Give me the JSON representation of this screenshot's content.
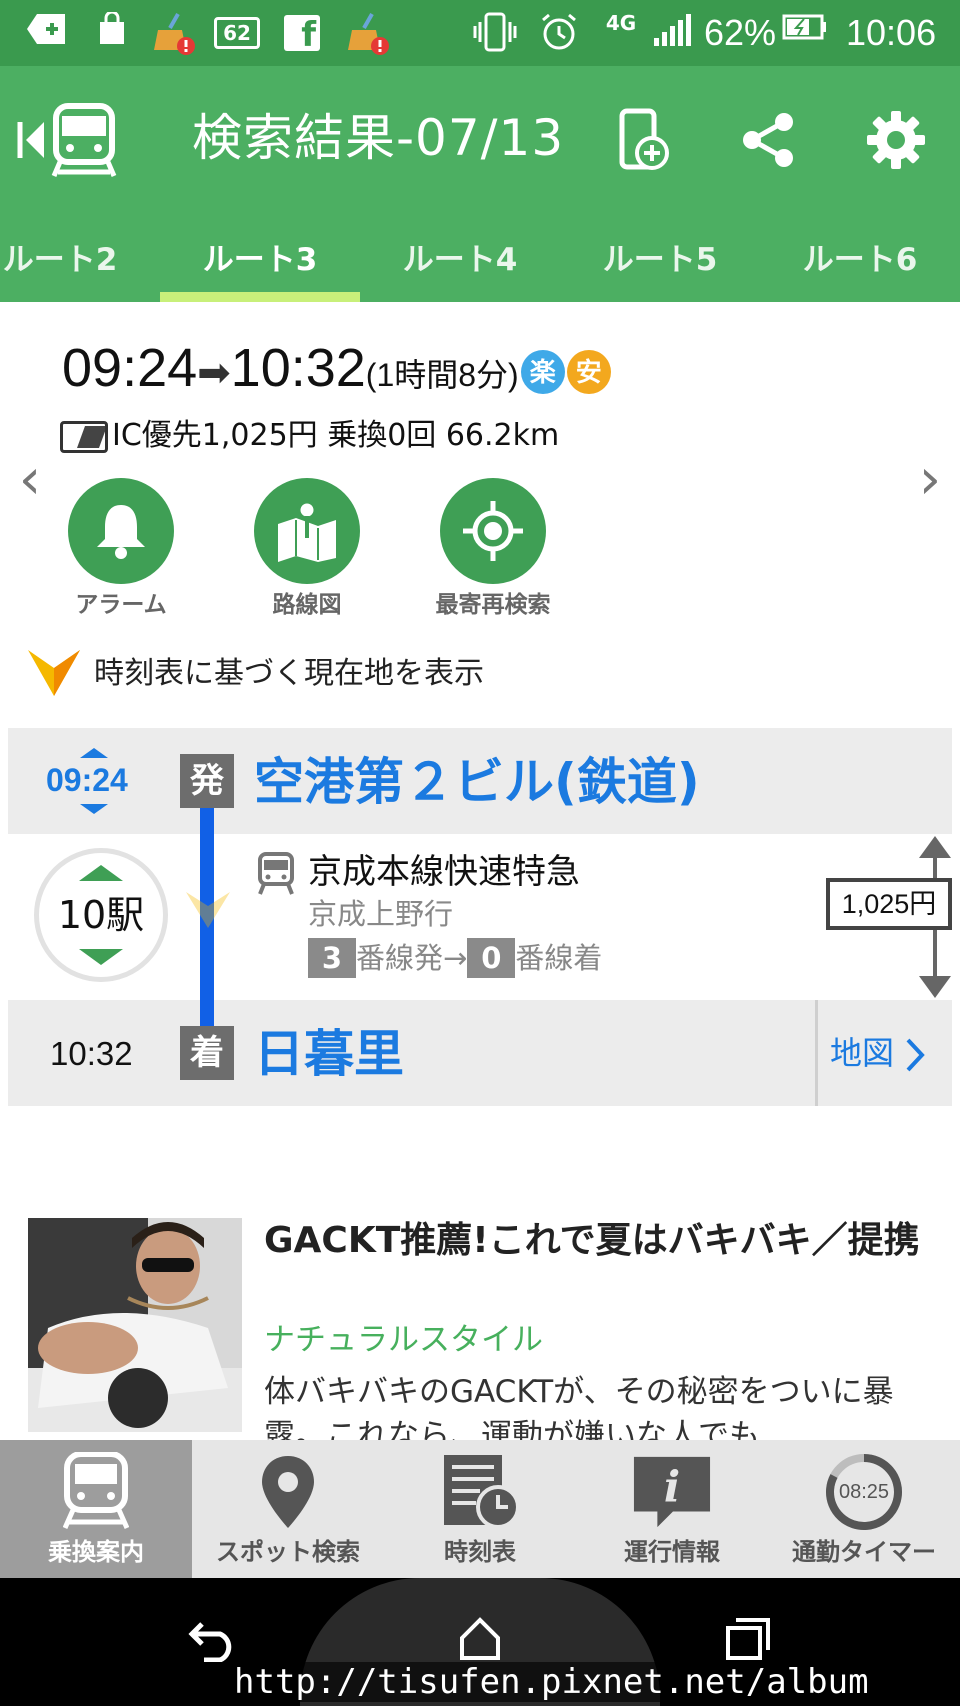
{
  "status_bar": {
    "battery_percent": "62%",
    "time": "10:06",
    "network": "4G",
    "notif_badge": "62",
    "facebook_glyph": "f",
    "icons": [
      "usb-plus-icon",
      "shopping-bag-icon",
      "broom-alert-icon",
      "badge-62-icon",
      "facebook-icon",
      "broom-alert-icon",
      "vibrate-icon",
      "alarm-icon",
      "4g-icon",
      "signal-icon",
      "battery-charging-icon"
    ]
  },
  "header": {
    "title": "検索結果-07/13",
    "icons": [
      "back-train-icon",
      "phone-add-icon",
      "share-icon",
      "settings-gear-icon"
    ]
  },
  "tabs": [
    {
      "label": "ルート2"
    },
    {
      "label": "ルート3"
    },
    {
      "label": "ルート4"
    },
    {
      "label": "ルート5"
    },
    {
      "label": "ルート6"
    }
  ],
  "summary": {
    "depart": "09:24",
    "arrow": "➡",
    "arrive": "10:32",
    "duration": "(1時間8分)",
    "badge_comfort": "楽",
    "badge_safe": "安",
    "fare_line": "IC優先1,025円 乗換0回 66.2km",
    "colors": {
      "comfort": "#3fa9e8",
      "safe": "#f3a81e"
    }
  },
  "nav_arrows": {
    "prev": "‹",
    "next": "›"
  },
  "actions": [
    {
      "label": "アラーム",
      "icon": "bell-icon"
    },
    {
      "label": "路線図",
      "icon": "route-map-icon"
    },
    {
      "label": "最寄再検索",
      "icon": "crosshair-icon"
    }
  ],
  "location_toggle": {
    "label": "時刻表に基づく現在地を表示"
  },
  "route": {
    "departure": {
      "time": "09:24",
      "tag": "発",
      "station": "空港第２ビル(鉄道)"
    },
    "stops": "10駅",
    "train": {
      "line": "京成本線快速特急",
      "destination": "京成上野行",
      "dep_platform": "3",
      "dep_suffix": "番線発→",
      "arr_platform": "0",
      "arr_suffix": "番線着"
    },
    "fare": "1,025円",
    "arrival": {
      "time": "10:32",
      "tag": "着",
      "station": "日暮里"
    },
    "map_link": "地図"
  },
  "ad": {
    "title": "GACKT推薦!これで夏はバキバキ／提携",
    "sponsor": "ナチュラルスタイル",
    "description": "体バキバキのGACKTが、その秘密をついに暴露。これなら、運動が嫌いな人でも…"
  },
  "bottom_nav": {
    "items": [
      {
        "label": "乗換案内",
        "icon": "train-icon"
      },
      {
        "label": "スポット検索",
        "icon": "location-pin-icon"
      },
      {
        "label": "時刻表",
        "icon": "timetable-icon"
      },
      {
        "label": "運行情報",
        "icon": "info-bubble-icon"
      },
      {
        "label": "通勤タイマー",
        "icon": "timer-icon"
      }
    ],
    "timer_value": "08:25"
  },
  "watermark": "http://tisufen.pixnet.net/album",
  "colors": {
    "header_green": "#4caf62",
    "status_green": "#3a9a4e",
    "accent_blue": "#1b7ae0",
    "tab_indicator": "#c8f07a"
  }
}
